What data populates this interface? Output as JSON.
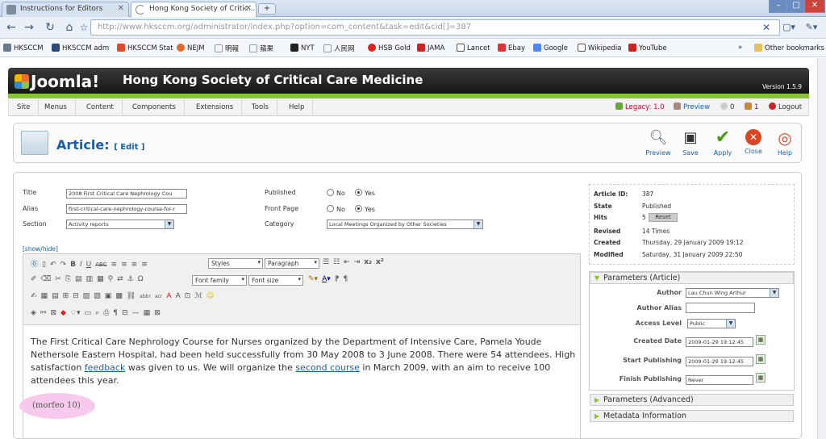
{
  "browser": {
    "tabs": [
      {
        "title": "Instructions for Editors",
        "active": false
      },
      {
        "title": "Hong Kong Society of Critic...",
        "active": true
      }
    ],
    "url_prefix": "http://www.hksccm.org",
    "url_rest": "/administrator/index.php?option=com_content&task=edit&cid[]=387",
    "bookmarks": [
      "HKSCCM",
      "HKSCCM adm",
      "HKSCCM Stat",
      "NEJM",
      "明報",
      "蘋果",
      "NYT",
      "人民网",
      "HSB Gold",
      "JAMA",
      "Lancet",
      "Ebay",
      "Google",
      "Wikipedia",
      "YouTube"
    ],
    "other_bookmarks": "Other bookmarks",
    "bookmark_more": "»"
  },
  "joomla": {
    "logo": "Joomla!",
    "site_name": "Hong Kong Society of Critical Care Medicine",
    "version": "Version 1.5.9",
    "menu": [
      "Site",
      "Menus",
      "Content",
      "Components",
      "Extensions",
      "Tools",
      "Help"
    ],
    "legacy": "Legacy: 1.0",
    "preview_link": "Preview",
    "messages": "0",
    "users": "1",
    "logout": "Logout"
  },
  "toolbar": {
    "title": "Article:",
    "subtitle": "[ Edit ]",
    "buttons": [
      "Preview",
      "Save",
      "Apply",
      "Close",
      "Help"
    ]
  },
  "form": {
    "title_label": "Title",
    "title_value": "2008 First Critical Care Nephrology Cou",
    "alias_label": "Alias",
    "alias_value": "first-critical-care-nephrology-course-for-r",
    "section_label": "Section",
    "section_value": "Activity reports",
    "published_label": "Published",
    "frontpage_label": "Front Page",
    "category_label": "Category",
    "category_value": "Local Meetings Organized by Other Societies",
    "no": "No",
    "yes": "Yes"
  },
  "editor": {
    "showhide": "[show/hide]",
    "styles": "Styles",
    "paragraph": "Paragraph",
    "font_family": "Font family",
    "font_size": "Font size",
    "text_1": "The First Critical Care Nephrology Course for Nurses organized by the Department of Intensive Care, Pamela Youde Nethersole Eastern Hospital, had been held successfully from 30 May 2008 to 3 June 2008. There were 54 attendees. High satisfaction ",
    "link_1": "feedback",
    "text_2": " was given to us. We will organize the ",
    "link_2": "second course",
    "text_3": " in March 2009, with an aim to receive 100 attendees this year.",
    "morfeo": "(morfeo 10)"
  },
  "info": {
    "article_id_label": "Article ID:",
    "article_id": "387",
    "state_label": "State",
    "state": "Published",
    "hits_label": "Hits",
    "hits": "5",
    "reset": "Reset",
    "revised_label": "Revised",
    "revised": "14 Times",
    "created_label": "Created",
    "created": "Thursday, 29 January 2009 19:12",
    "modified_label": "Modified",
    "modified": "Saturday, 31 January 2009 22:50"
  },
  "params": {
    "header": "Parameters (Article)",
    "author_label": "Author",
    "author": "Lau Chun Wing Arthur",
    "alias_label": "Author Alias",
    "access_label": "Access Level",
    "access": "Public",
    "created_label": "Created Date",
    "created": "2009-01-29 19:12:45",
    "start_label": "Start Publishing",
    "start": "2009-01-29 19:12:45",
    "finish_label": "Finish Publishing",
    "finish": "Never",
    "advanced": "Parameters (Advanced)",
    "metadata": "Metadata Information"
  }
}
